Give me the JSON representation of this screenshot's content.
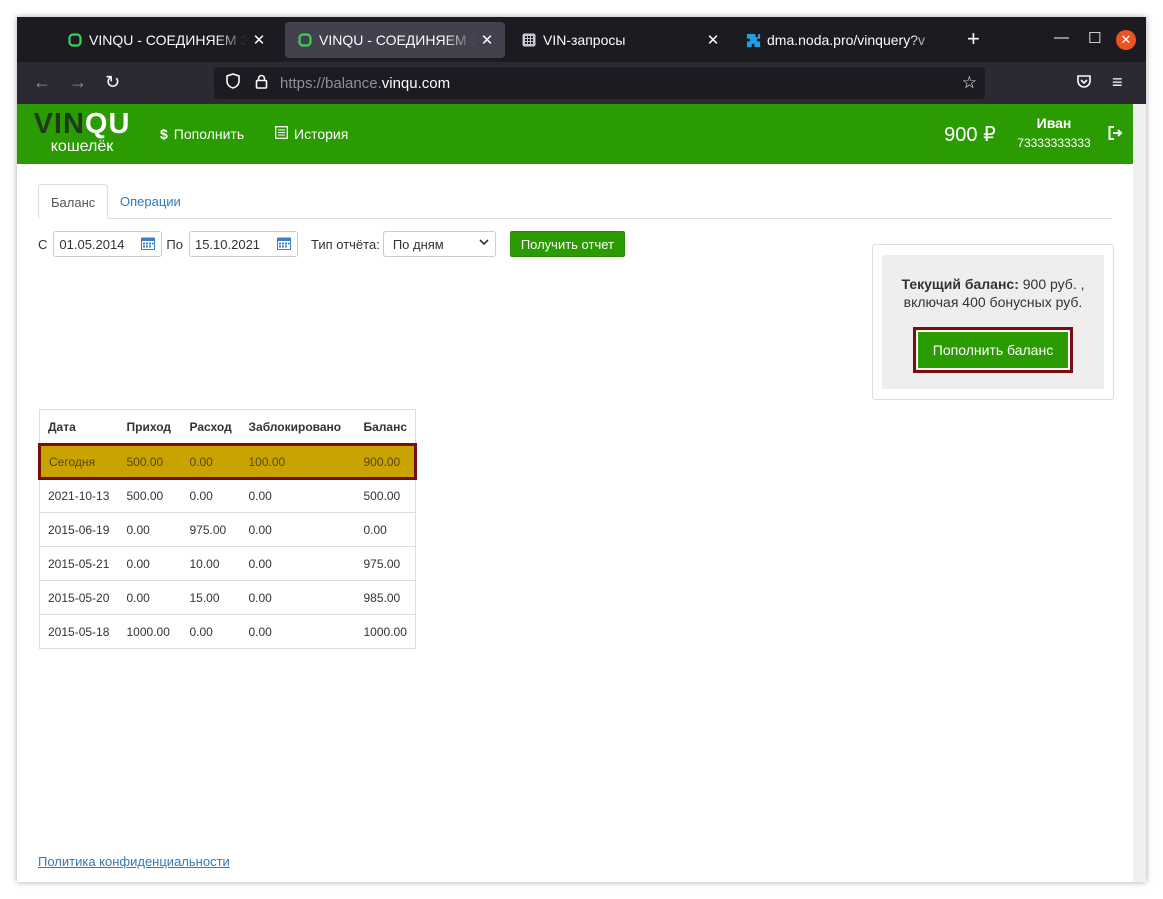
{
  "browser": {
    "tabs": [
      {
        "title": "VINQU - СОЕДИНЯЕМ ЭКСПЕРТОВ",
        "icon": "vinqu-icon",
        "active": false
      },
      {
        "title": "VINQU - СОЕДИНЯЕМ ЭКСПЕРТОВ",
        "icon": "vinqu-icon",
        "active": true
      },
      {
        "title": "VIN-запросы",
        "icon": "grid-icon",
        "active": false
      },
      {
        "title": "dma.noda.pro/vinquery?v",
        "icon": "puzzle-icon",
        "active": false
      }
    ],
    "url_prefix": "https://balance.",
    "url_domain": "vinqu.com"
  },
  "header": {
    "logo_main_1": "VIN",
    "logo_main_2": "QU",
    "logo_sub": "кошелёк",
    "nav_topup": "Пополнить",
    "nav_history": "История",
    "balance": "900 ₽",
    "user_name": "Иван",
    "user_phone": "73333333333"
  },
  "page_tabs": {
    "balance": "Баланс",
    "operations": "Операции"
  },
  "filters": {
    "from_label": "С",
    "from_value": "01.05.2014",
    "to_label": "По",
    "to_value": "15.10.2021",
    "type_label": "Тип отчёта:",
    "type_value": "По дням",
    "submit": "Получить отчет"
  },
  "balance_card": {
    "label": "Текущий баланс:",
    "amount": "900 руб. ,",
    "bonus": "включая 400 бонусных руб.",
    "button": "Пополнить баланс"
  },
  "table": {
    "headers": [
      "Дата",
      "Приход",
      "Расход",
      "Заблокировано",
      "Баланс"
    ],
    "rows": [
      [
        "Сегодня",
        "500.00",
        "0.00",
        "100.00",
        "900.00"
      ],
      [
        "2021-10-13",
        "500.00",
        "0.00",
        "0.00",
        "500.00"
      ],
      [
        "2015-06-19",
        "0.00",
        "975.00",
        "0.00",
        "0.00"
      ],
      [
        "2015-05-21",
        "0.00",
        "10.00",
        "0.00",
        "975.00"
      ],
      [
        "2015-05-20",
        "0.00",
        "15.00",
        "0.00",
        "985.00"
      ],
      [
        "2015-05-18",
        "1000.00",
        "0.00",
        "0.00",
        "1000.00"
      ]
    ]
  },
  "footer": {
    "privacy": "Политика конфиденциальности"
  },
  "colors": {
    "brand_green": "#2a9c02",
    "highlight_row": "#c9a300",
    "highlight_border": "#7a0d10",
    "link": "#337ab7"
  }
}
